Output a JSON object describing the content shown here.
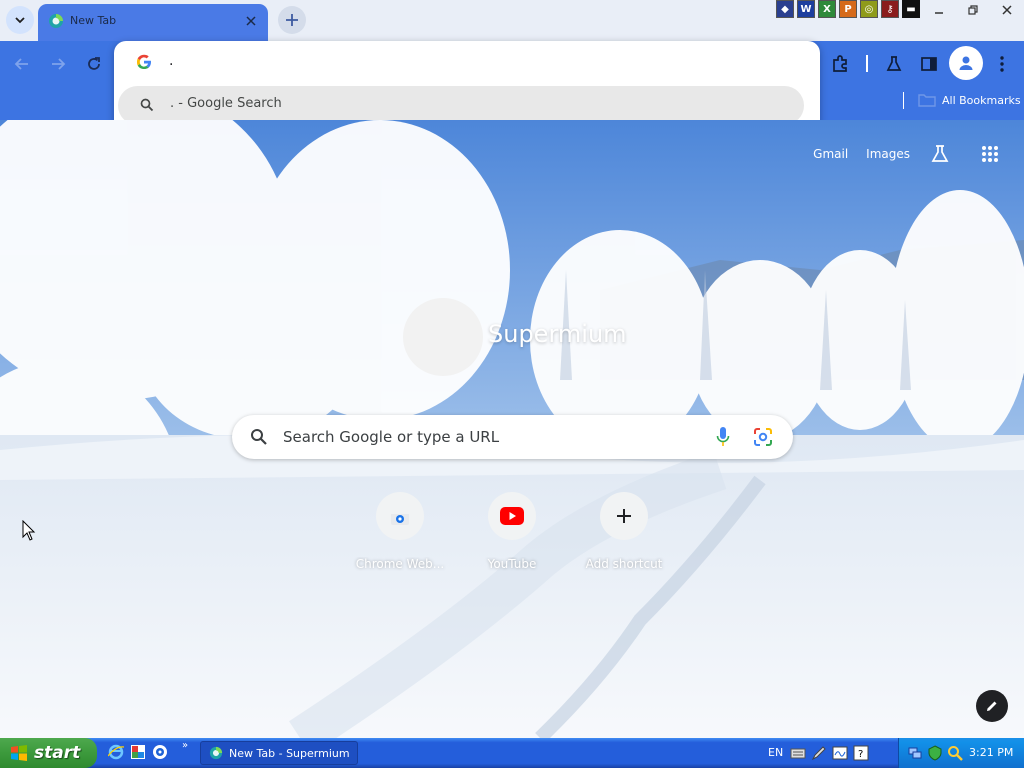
{
  "browser": {
    "tab": {
      "title": "New Tab"
    },
    "omnibox": {
      "input_text": ".",
      "suggestion_text": ". - Google Search"
    },
    "bookmarks": {
      "all_bookmarks_label": "All Bookmarks"
    },
    "toolbar_icons": [
      "back-icon",
      "forward-icon",
      "reload-icon",
      "extensions-icon",
      "labs-icon",
      "side-panel-icon",
      "profile-icon",
      "menu-icon"
    ]
  },
  "ntp": {
    "links": {
      "gmail": "Gmail",
      "images": "Images"
    },
    "logo_text": "Supermium",
    "search_placeholder": "Search Google or type a URL",
    "shortcuts": [
      {
        "label": "Chrome Web...",
        "icon": "chrome-web-store-icon"
      },
      {
        "label": "YouTube",
        "icon": "youtube-icon"
      },
      {
        "label": "Add shortcut",
        "icon": "plus-icon"
      }
    ]
  },
  "taskbar": {
    "start_label": "start",
    "task_button_label": "New Tab - Supermium",
    "language": "EN",
    "clock": "3:21 PM"
  },
  "colors": {
    "tab_active": "#4a7ae6",
    "toolbar": "#3d74e2",
    "taskbar": "#245edb",
    "start_button": "#3c9a3c",
    "youtube_red": "#ff0000"
  }
}
